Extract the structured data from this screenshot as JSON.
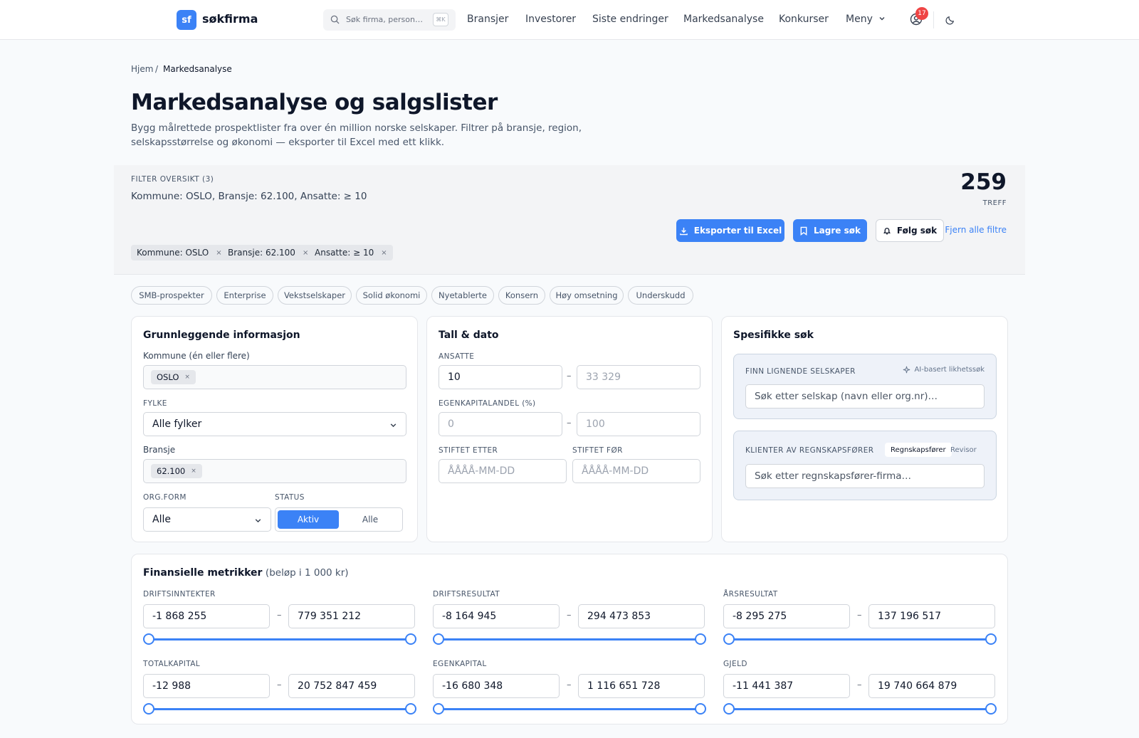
{
  "nav": {
    "logo_mark": "sf",
    "logo_text": "søkfirma",
    "search_placeholder": "Søk firma, person…",
    "search_shortcut": "⌘K",
    "links": [
      "Bransjer",
      "Investorer",
      "Siste endringer",
      "Markedsanalyse",
      "Konkurser"
    ],
    "menu_label": "Meny",
    "notification_count": "17"
  },
  "breadcrumb": {
    "home": "Hjem",
    "sep": "/",
    "current": "Markedsanalyse"
  },
  "page": {
    "title": "Markedsanalyse og salgslister",
    "lead": "Bygg målrettede prospektlister fra over én million norske selskaper. Filtrer på bransje, region, selskapsstørrelse og økonomi — eksporter til Excel med ett klikk."
  },
  "filter": {
    "title": "FILTER OVERSIKT (3)",
    "summary": "Kommune: OSLO, Bransje: 62.100, Ansatte: ≥ 10",
    "hits": "259",
    "hits_label": "TREFF",
    "export_label": "Eksporter til Excel",
    "save_label": "Lagre søk",
    "follow_label": "Følg søk",
    "clear_label": "Fjern alle filtre",
    "chips": [
      "Kommune: OSLO",
      "Bransje: 62.100",
      "Ansatte: ≥ 10"
    ],
    "chip_remove": "×"
  },
  "presets": [
    "SMB-prospekter",
    "Enterprise",
    "Vekstselskaper",
    "Solid økonomi",
    "Nyetablerte",
    "Konsern",
    "Høy omsetning",
    "Underskudd"
  ],
  "basic": {
    "title": "Grunnleggende informasjon",
    "kommune_label": "Kommune (én eller flere)",
    "kommune_tag": "OSLO",
    "fylke_label": "FYLKE",
    "fylke_value": "Alle fylker",
    "bransje_label": "Bransje",
    "bransje_tag": "62.100",
    "orgform_label": "ORG.FORM",
    "orgform_value": "Alle",
    "status_label": "STATUS",
    "status_active": "Aktiv",
    "status_all": "Alle"
  },
  "numbers": {
    "title": "Tall & dato",
    "ansatte_label": "ANSATTE",
    "ansatte_min": "10",
    "ansatte_max_ph": "33 329",
    "ek_label": "EGENKAPITALANDEL (%)",
    "ek_min_ph": "0",
    "ek_max_ph": "100",
    "after_label": "STIFTET ETTER",
    "before_label": "STIFTET FØR",
    "date_ph": "ÅÅÅÅ-MM-DD",
    "range_dash": "–"
  },
  "specific": {
    "title": "Spesifikke søk",
    "similar_label": "FINN LIGNENDE SELSKAPER",
    "ai_label": "AI-basert likhetssøk",
    "similar_ph": "Søk etter selskap (navn eller org.nr)…",
    "accountant_label": "KLIENTER AV REGNSKAPSFØRER",
    "toggle_a": "Regnskapsfører",
    "toggle_b": "Revisor",
    "accountant_ph": "Søk etter regnskapsfører-firma…"
  },
  "finance": {
    "title": "Finansielle metrikker",
    "unit": "(beløp i 1 000 kr)",
    "metrics": [
      {
        "label": "DRIFTSINNTEKTER",
        "min": "-1 868 255",
        "max": "779 351 212"
      },
      {
        "label": "DRIFTSRESULTAT",
        "min": "-8 164 945",
        "max": "294 473 853"
      },
      {
        "label": "ÅRSRESULTAT",
        "min": "-8 295 275",
        "max": "137 196 517"
      },
      {
        "label": "TOTALKAPITAL",
        "min": "-12 988",
        "max": "20 752 847 459"
      },
      {
        "label": "EGENKAPITAL",
        "min": "-16 680 348",
        "max": "1 116 651 728"
      },
      {
        "label": "GJELD",
        "min": "-11 441 387",
        "max": "19 740 664 879"
      }
    ]
  },
  "colors": {
    "accent": "#3b82f6",
    "badge": "#ef4444"
  }
}
